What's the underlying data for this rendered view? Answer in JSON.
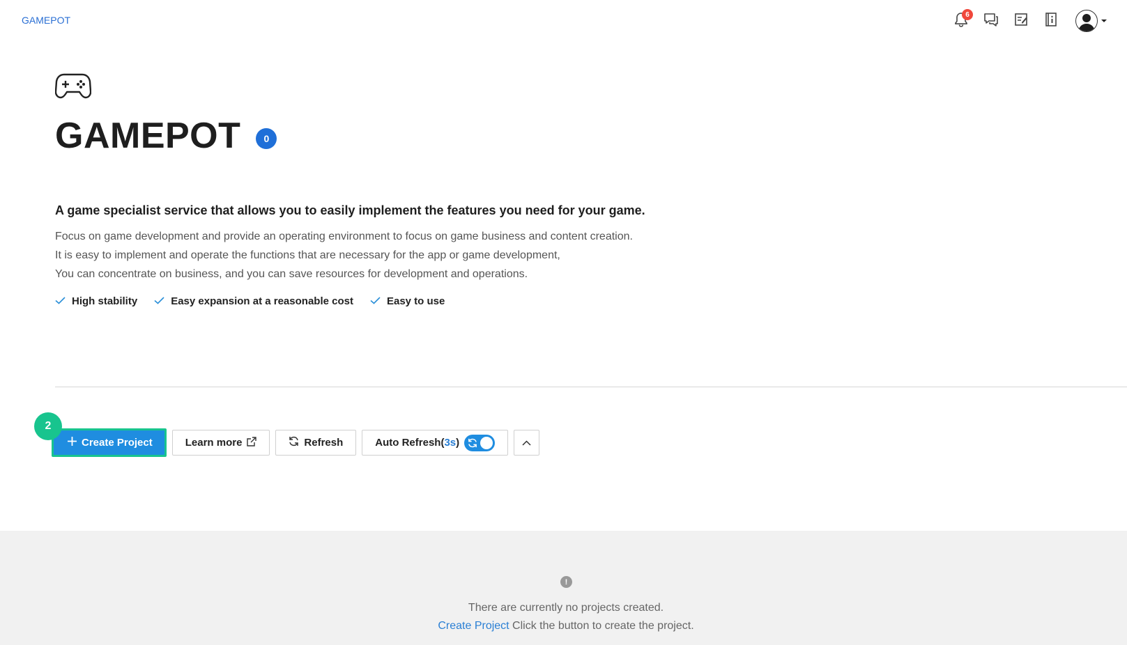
{
  "header": {
    "breadcrumb": "GAMEPOT",
    "notification_count": "6",
    "icons": [
      "bell-icon",
      "chat-icon",
      "memo-icon",
      "info-book-icon",
      "user-avatar-icon"
    ]
  },
  "hero": {
    "icon": "gamepad-icon",
    "title": "GAMEPOT",
    "project_count": "0",
    "headline": "A game specialist service that allows you to easily implement the features you need for your game.",
    "description": [
      "Focus on game development and provide an operating environment to focus on game business and content creation.",
      "It is easy to implement and operate the functions that are necessary for the app or game development,",
      "You can concentrate on business, and you can save resources for development and operations."
    ],
    "features": [
      "High stability",
      "Easy expansion at a reasonable cost",
      "Easy to use"
    ]
  },
  "toolbar": {
    "step_number": "2",
    "create_label": "Create Project",
    "learn_more_label": "Learn more",
    "refresh_label": "Refresh",
    "auto_refresh_label": "Auto Refresh(",
    "auto_refresh_interval": "3s",
    "auto_refresh_close": ")",
    "auto_refresh_enabled": true
  },
  "empty_state": {
    "icon_glyph": "!",
    "message": "There are currently no projects created.",
    "link_label": "Create Project",
    "hint": " Click the button to create the project."
  },
  "colors": {
    "accent": "#1f8de0",
    "highlight": "#18c48e",
    "badge": "#1f6fd8",
    "notification": "#f0473b",
    "link": "#2a7fd4"
  }
}
